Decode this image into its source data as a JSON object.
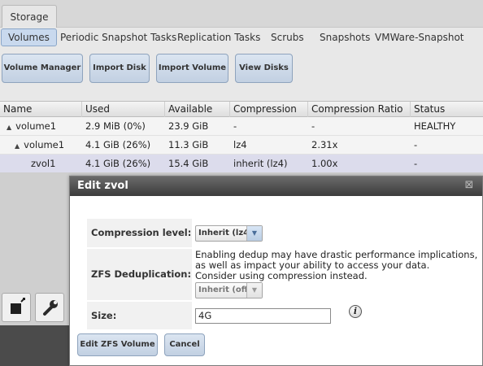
{
  "top_tabs": [
    "Storage"
  ],
  "sub_tabs": [
    "Volumes",
    "Periodic Snapshot Tasks",
    "Replication Tasks",
    "Scrubs",
    "Snapshots",
    "VMWare-Snapshot"
  ],
  "toolbar": {
    "volume_manager": "Volume Manager",
    "import_disk": "Import Disk",
    "import_volume": "Import Volume",
    "view_disks": "View Disks"
  },
  "grid": {
    "columns": [
      "Name",
      "Used",
      "Available",
      "Compression",
      "Compression Ratio",
      "Status"
    ],
    "rows": [
      {
        "expander": "▲",
        "name": "volume1",
        "used": "2.9 MiB (0%)",
        "available": "23.9 GiB",
        "compression": "-",
        "ratio": "-",
        "status": "HEALTHY"
      },
      {
        "expander": "▲",
        "name": "volume1",
        "used": "4.1 GiB (26%)",
        "available": "11.3 GiB",
        "compression": "lz4",
        "ratio": "2.31x",
        "status": "-"
      },
      {
        "expander": "",
        "name": "zvol1",
        "used": "4.1 GiB (26%)",
        "available": "15.4 GiB",
        "compression": "inherit (lz4)",
        "ratio": "1.00x",
        "status": "-"
      }
    ]
  },
  "dialog": {
    "title": "Edit zvol",
    "close_glyph": "⊠",
    "compression_label": "Compression level:",
    "compression_value": "Inherit (lz4)",
    "dedup_label": "ZFS Deduplication:",
    "dedup_note_line1": "Enabling dedup may have drastic performance implications,",
    "dedup_note_line2": "as well as impact your ability to access your data.",
    "dedup_note_line3": "Consider using compression instead.",
    "dedup_value": "Inherit (off)",
    "size_label": "Size:",
    "size_value": "4G",
    "info_glyph": "i",
    "submit_label": "Edit ZFS Volume",
    "cancel_label": "Cancel"
  },
  "colors": {
    "title_bar": "#3c3c3c",
    "button_top": "#dbe5f1",
    "button_bottom": "#c2d0e2",
    "selected_row": "#dcdcec"
  }
}
